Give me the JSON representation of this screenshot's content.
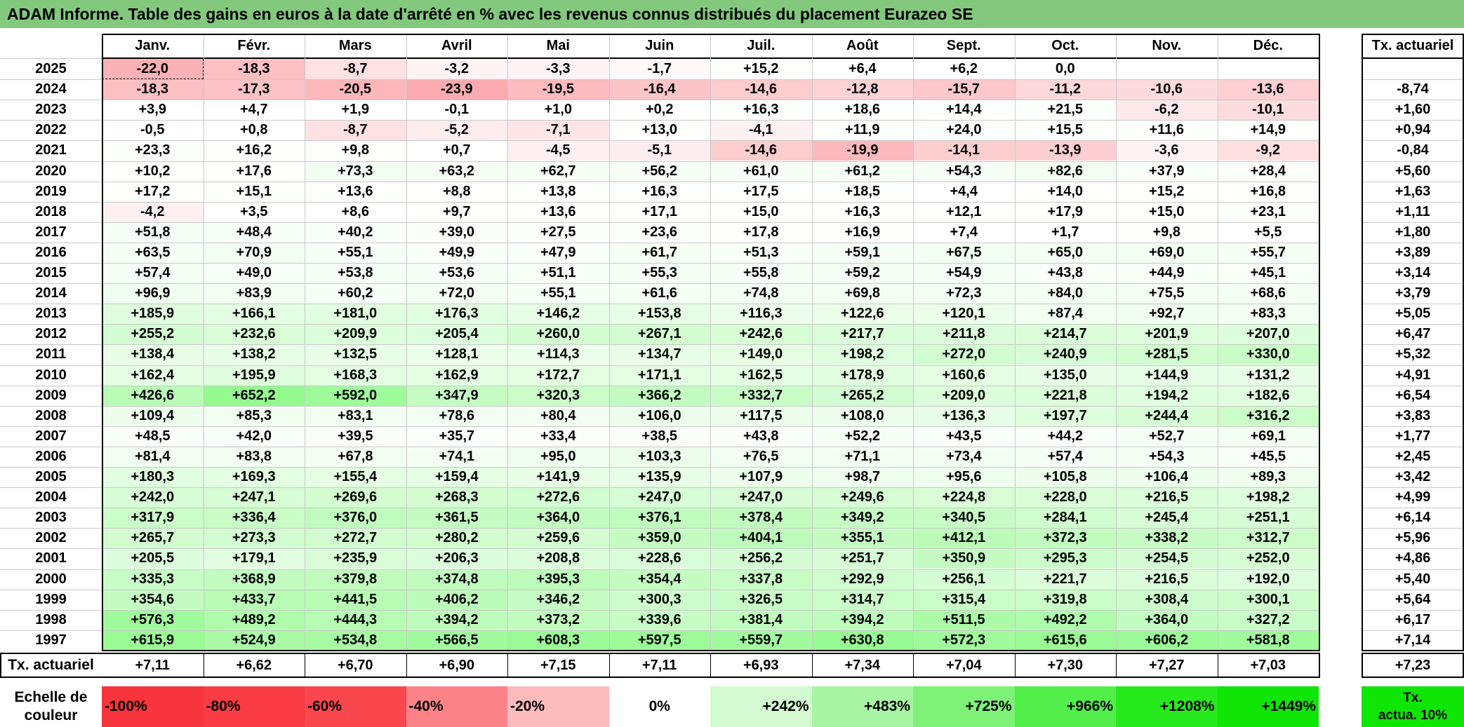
{
  "title": "ADAM Informe. Table des gains en euros à la date d'arrêté en % avec les revenus connus distribués du placement Eurazeo SE",
  "months": [
    "Janv.",
    "Févr.",
    "Mars",
    "Avril",
    "Mai",
    "Juin",
    "Juil.",
    "Août",
    "Sept.",
    "Oct.",
    "Nov.",
    "Déc."
  ],
  "rate_header": "Tx. actuariel",
  "rows": [
    {
      "year": "2025",
      "values": [
        "-22,0",
        "-18,3",
        "-8,7",
        "-3,2",
        "-3,3",
        "-1,7",
        "+15,2",
        "+6,4",
        "+6,2",
        "0,0",
        "",
        ""
      ],
      "rate": ""
    },
    {
      "year": "2024",
      "values": [
        "-18,3",
        "-17,3",
        "-20,5",
        "-23,9",
        "-19,5",
        "-16,4",
        "-14,6",
        "-12,8",
        "-15,7",
        "-11,2",
        "-10,6",
        "-13,6"
      ],
      "rate": "-8,74"
    },
    {
      "year": "2023",
      "values": [
        "+3,9",
        "+4,7",
        "+1,9",
        "-0,1",
        "+1,0",
        "+0,2",
        "+16,3",
        "+18,6",
        "+14,4",
        "+21,5",
        "-6,2",
        "-10,1"
      ],
      "rate": "+1,60"
    },
    {
      "year": "2022",
      "values": [
        "-0,5",
        "+0,8",
        "-8,7",
        "-5,2",
        "-7,1",
        "+13,0",
        "-4,1",
        "+11,9",
        "+24,0",
        "+15,5",
        "+11,6",
        "+14,9"
      ],
      "rate": "+0,94"
    },
    {
      "year": "2021",
      "values": [
        "+23,3",
        "+16,2",
        "+9,8",
        "+0,7",
        "-4,5",
        "-5,1",
        "-14,6",
        "-19,9",
        "-14,1",
        "-13,9",
        "-3,6",
        "-9,2"
      ],
      "rate": "-0,84"
    },
    {
      "year": "2020",
      "values": [
        "+10,2",
        "+17,6",
        "+73,3",
        "+63,2",
        "+62,7",
        "+56,2",
        "+61,0",
        "+61,2",
        "+54,3",
        "+82,6",
        "+37,9",
        "+28,4"
      ],
      "rate": "+5,60"
    },
    {
      "year": "2019",
      "values": [
        "+17,2",
        "+15,1",
        "+13,6",
        "+8,8",
        "+13,8",
        "+16,3",
        "+17,5",
        "+18,5",
        "+4,4",
        "+14,0",
        "+15,2",
        "+16,8"
      ],
      "rate": "+1,63"
    },
    {
      "year": "2018",
      "values": [
        "-4,2",
        "+3,5",
        "+8,6",
        "+9,7",
        "+13,6",
        "+17,1",
        "+15,0",
        "+16,3",
        "+12,1",
        "+17,9",
        "+15,0",
        "+23,1"
      ],
      "rate": "+1,11"
    },
    {
      "year": "2017",
      "values": [
        "+51,8",
        "+48,4",
        "+40,2",
        "+39,0",
        "+27,5",
        "+23,6",
        "+17,8",
        "+16,9",
        "+7,4",
        "+1,7",
        "+9,8",
        "+5,5"
      ],
      "rate": "+1,80"
    },
    {
      "year": "2016",
      "values": [
        "+63,5",
        "+70,9",
        "+55,1",
        "+49,9",
        "+47,9",
        "+61,7",
        "+51,3",
        "+59,1",
        "+67,5",
        "+65,0",
        "+69,0",
        "+55,7"
      ],
      "rate": "+3,89"
    },
    {
      "year": "2015",
      "values": [
        "+57,4",
        "+49,0",
        "+53,8",
        "+53,6",
        "+51,1",
        "+55,3",
        "+55,8",
        "+59,2",
        "+54,9",
        "+43,8",
        "+44,9",
        "+45,1"
      ],
      "rate": "+3,14"
    },
    {
      "year": "2014",
      "values": [
        "+96,9",
        "+83,9",
        "+60,2",
        "+72,0",
        "+55,1",
        "+61,6",
        "+74,8",
        "+69,8",
        "+72,3",
        "+84,0",
        "+75,5",
        "+68,6"
      ],
      "rate": "+3,79"
    },
    {
      "year": "2013",
      "values": [
        "+185,9",
        "+166,1",
        "+181,0",
        "+176,3",
        "+146,2",
        "+153,8",
        "+116,3",
        "+122,6",
        "+120,1",
        "+87,4",
        "+92,7",
        "+83,3"
      ],
      "rate": "+5,05"
    },
    {
      "year": "2012",
      "values": [
        "+255,2",
        "+232,6",
        "+209,9",
        "+205,4",
        "+260,0",
        "+267,1",
        "+242,6",
        "+217,7",
        "+211,8",
        "+214,7",
        "+201,9",
        "+207,0"
      ],
      "rate": "+6,47"
    },
    {
      "year": "2011",
      "values": [
        "+138,4",
        "+138,2",
        "+132,5",
        "+128,1",
        "+114,3",
        "+134,7",
        "+149,0",
        "+198,2",
        "+272,0",
        "+240,9",
        "+281,5",
        "+330,0"
      ],
      "rate": "+5,32"
    },
    {
      "year": "2010",
      "values": [
        "+162,4",
        "+195,9",
        "+168,3",
        "+162,9",
        "+172,7",
        "+171,1",
        "+162,5",
        "+178,9",
        "+160,6",
        "+135,0",
        "+144,9",
        "+131,2"
      ],
      "rate": "+4,91"
    },
    {
      "year": "2009",
      "values": [
        "+426,6",
        "+652,2",
        "+592,0",
        "+347,9",
        "+320,3",
        "+366,2",
        "+332,7",
        "+265,2",
        "+209,0",
        "+221,8",
        "+194,2",
        "+182,6"
      ],
      "rate": "+6,54"
    },
    {
      "year": "2008",
      "values": [
        "+109,4",
        "+85,3",
        "+83,1",
        "+78,6",
        "+80,4",
        "+106,0",
        "+117,5",
        "+108,0",
        "+136,3",
        "+197,7",
        "+244,4",
        "+316,2"
      ],
      "rate": "+3,83"
    },
    {
      "year": "2007",
      "values": [
        "+48,5",
        "+42,0",
        "+39,5",
        "+35,7",
        "+33,4",
        "+38,5",
        "+43,8",
        "+52,2",
        "+43,5",
        "+44,2",
        "+52,7",
        "+69,1"
      ],
      "rate": "+1,77"
    },
    {
      "year": "2006",
      "values": [
        "+81,4",
        "+83,8",
        "+67,8",
        "+74,1",
        "+95,0",
        "+103,3",
        "+76,5",
        "+71,1",
        "+73,4",
        "+57,4",
        "+54,3",
        "+45,5"
      ],
      "rate": "+2,45"
    },
    {
      "year": "2005",
      "values": [
        "+180,3",
        "+169,3",
        "+155,4",
        "+159,4",
        "+141,9",
        "+135,9",
        "+107,9",
        "+98,7",
        "+95,6",
        "+105,8",
        "+106,4",
        "+89,3"
      ],
      "rate": "+3,42"
    },
    {
      "year": "2004",
      "values": [
        "+242,0",
        "+247,1",
        "+269,6",
        "+268,3",
        "+272,6",
        "+247,0",
        "+247,0",
        "+249,6",
        "+224,8",
        "+228,0",
        "+216,5",
        "+198,2"
      ],
      "rate": "+4,99"
    },
    {
      "year": "2003",
      "values": [
        "+317,9",
        "+336,4",
        "+376,0",
        "+361,5",
        "+364,0",
        "+376,1",
        "+378,4",
        "+349,2",
        "+340,5",
        "+284,1",
        "+245,4",
        "+251,1"
      ],
      "rate": "+6,14"
    },
    {
      "year": "2002",
      "values": [
        "+265,7",
        "+273,3",
        "+272,7",
        "+280,2",
        "+259,6",
        "+359,0",
        "+404,1",
        "+355,1",
        "+412,1",
        "+372,3",
        "+338,2",
        "+312,7"
      ],
      "rate": "+5,96"
    },
    {
      "year": "2001",
      "values": [
        "+205,5",
        "+179,1",
        "+235,9",
        "+206,3",
        "+208,8",
        "+228,6",
        "+256,2",
        "+251,7",
        "+350,9",
        "+295,3",
        "+254,5",
        "+252,0"
      ],
      "rate": "+4,86"
    },
    {
      "year": "2000",
      "values": [
        "+335,3",
        "+368,9",
        "+379,8",
        "+374,8",
        "+395,3",
        "+354,4",
        "+337,8",
        "+292,9",
        "+256,1",
        "+221,7",
        "+216,5",
        "+192,0"
      ],
      "rate": "+5,40"
    },
    {
      "year": "1999",
      "values": [
        "+354,6",
        "+433,7",
        "+441,5",
        "+406,2",
        "+346,2",
        "+300,3",
        "+326,5",
        "+314,7",
        "+315,4",
        "+319,8",
        "+308,4",
        "+300,1"
      ],
      "rate": "+5,64"
    },
    {
      "year": "1998",
      "values": [
        "+576,3",
        "+489,2",
        "+444,3",
        "+394,2",
        "+373,2",
        "+339,6",
        "+381,4",
        "+394,2",
        "+511,5",
        "+492,2",
        "+364,0",
        "+327,2"
      ],
      "rate": "+6,17"
    },
    {
      "year": "1997",
      "values": [
        "+615,9",
        "+524,9",
        "+534,8",
        "+566,5",
        "+608,3",
        "+597,5",
        "+559,7",
        "+630,8",
        "+572,3",
        "+615,6",
        "+606,2",
        "+581,8"
      ],
      "rate": "+7,14"
    }
  ],
  "footer": {
    "label": "Tx. actuariel",
    "values": [
      "+7,11",
      "+6,62",
      "+6,70",
      "+6,90",
      "+7,15",
      "+7,11",
      "+6,93",
      "+7,34",
      "+7,04",
      "+7,30",
      "+7,27",
      "+7,03"
    ],
    "overall": "+7,23"
  },
  "scale": {
    "label_line1": "Echelle de",
    "label_line2": "couleur",
    "steps": [
      {
        "label": "-100%",
        "color": "#f8343c",
        "align": "left"
      },
      {
        "label": "-80%",
        "color": "#f93c44",
        "align": "left"
      },
      {
        "label": "-60%",
        "color": "#fa474e",
        "align": "left"
      },
      {
        "label": "-40%",
        "color": "#fb8388",
        "align": "left"
      },
      {
        "label": "-20%",
        "color": "#fcbcbe",
        "align": "left"
      },
      {
        "label": "0%",
        "color": "#ffffff",
        "align": "center"
      },
      {
        "label": "+242%",
        "color": "#d4fad1",
        "align": "right"
      },
      {
        "label": "+483%",
        "color": "#a8f6a3",
        "align": "right"
      },
      {
        "label": "+725%",
        "color": "#7df277",
        "align": "right"
      },
      {
        "label": "+966%",
        "color": "#52ee4a",
        "align": "right"
      },
      {
        "label": "+1208%",
        "color": "#27ea1d",
        "align": "right"
      },
      {
        "label": "+1449%",
        "color": "#0fe606",
        "align": "right"
      }
    ],
    "rate_line1": "Tx.",
    "rate_line2": "actua. 10%",
    "rate_color": "#0fe606"
  }
}
